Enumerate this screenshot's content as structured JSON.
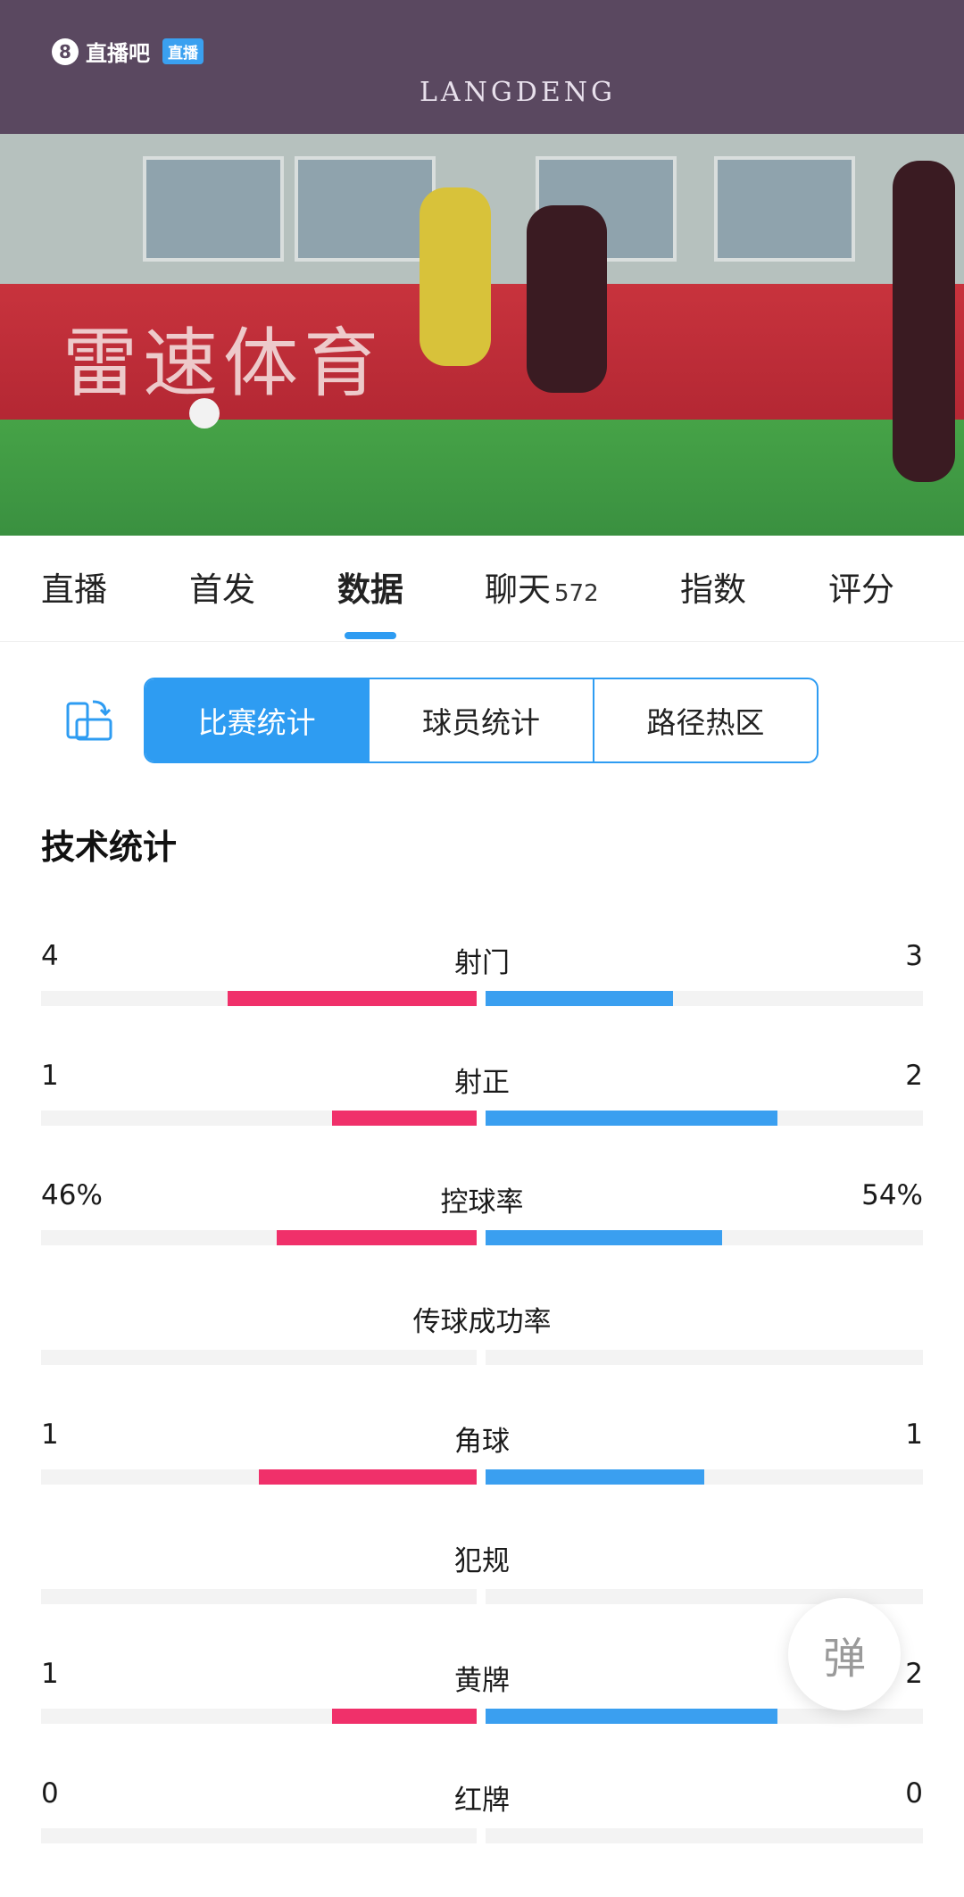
{
  "video": {
    "watermark_text": "直播吧",
    "watermark_badge": "直播",
    "stadium_logo": "LANGDENG",
    "ad_board_text": "雷速体育"
  },
  "tabs": [
    {
      "label": "直播",
      "count": ""
    },
    {
      "label": "首发",
      "count": ""
    },
    {
      "label": "数据",
      "count": "",
      "active": true
    },
    {
      "label": "聊天",
      "count": "572"
    },
    {
      "label": "指数",
      "count": ""
    },
    {
      "label": "评分",
      "count": ""
    }
  ],
  "segmented": {
    "icon": "rotate-screen-icon",
    "items": [
      "比赛统计",
      "球员统计",
      "路径热区"
    ],
    "active_index": 0
  },
  "section_title": "技术统计",
  "colors": {
    "home": "#f0306a",
    "away": "#3a9ff0",
    "accent": "#2e9cf2"
  },
  "stats": [
    {
      "name": "射门",
      "home": "4",
      "away": "3",
      "home_fraction": 0.571,
      "away_fraction": 0.429
    },
    {
      "name": "射正",
      "home": "1",
      "away": "2",
      "home_fraction": 0.333,
      "away_fraction": 0.667
    },
    {
      "name": "控球率",
      "home": "46%",
      "away": "54%",
      "home_fraction": 0.46,
      "away_fraction": 0.54
    },
    {
      "name": "传球成功率",
      "home": "",
      "away": "",
      "home_fraction": 0,
      "away_fraction": 0
    },
    {
      "name": "角球",
      "home": "1",
      "away": "1",
      "home_fraction": 0.5,
      "away_fraction": 0.5
    },
    {
      "name": "犯规",
      "home": "",
      "away": "",
      "home_fraction": 0,
      "away_fraction": 0
    },
    {
      "name": "黄牌",
      "home": "1",
      "away": "2",
      "home_fraction": 0.333,
      "away_fraction": 0.667
    },
    {
      "name": "红牌",
      "home": "0",
      "away": "0",
      "home_fraction": 0,
      "away_fraction": 0
    }
  ],
  "float_button": "弹"
}
